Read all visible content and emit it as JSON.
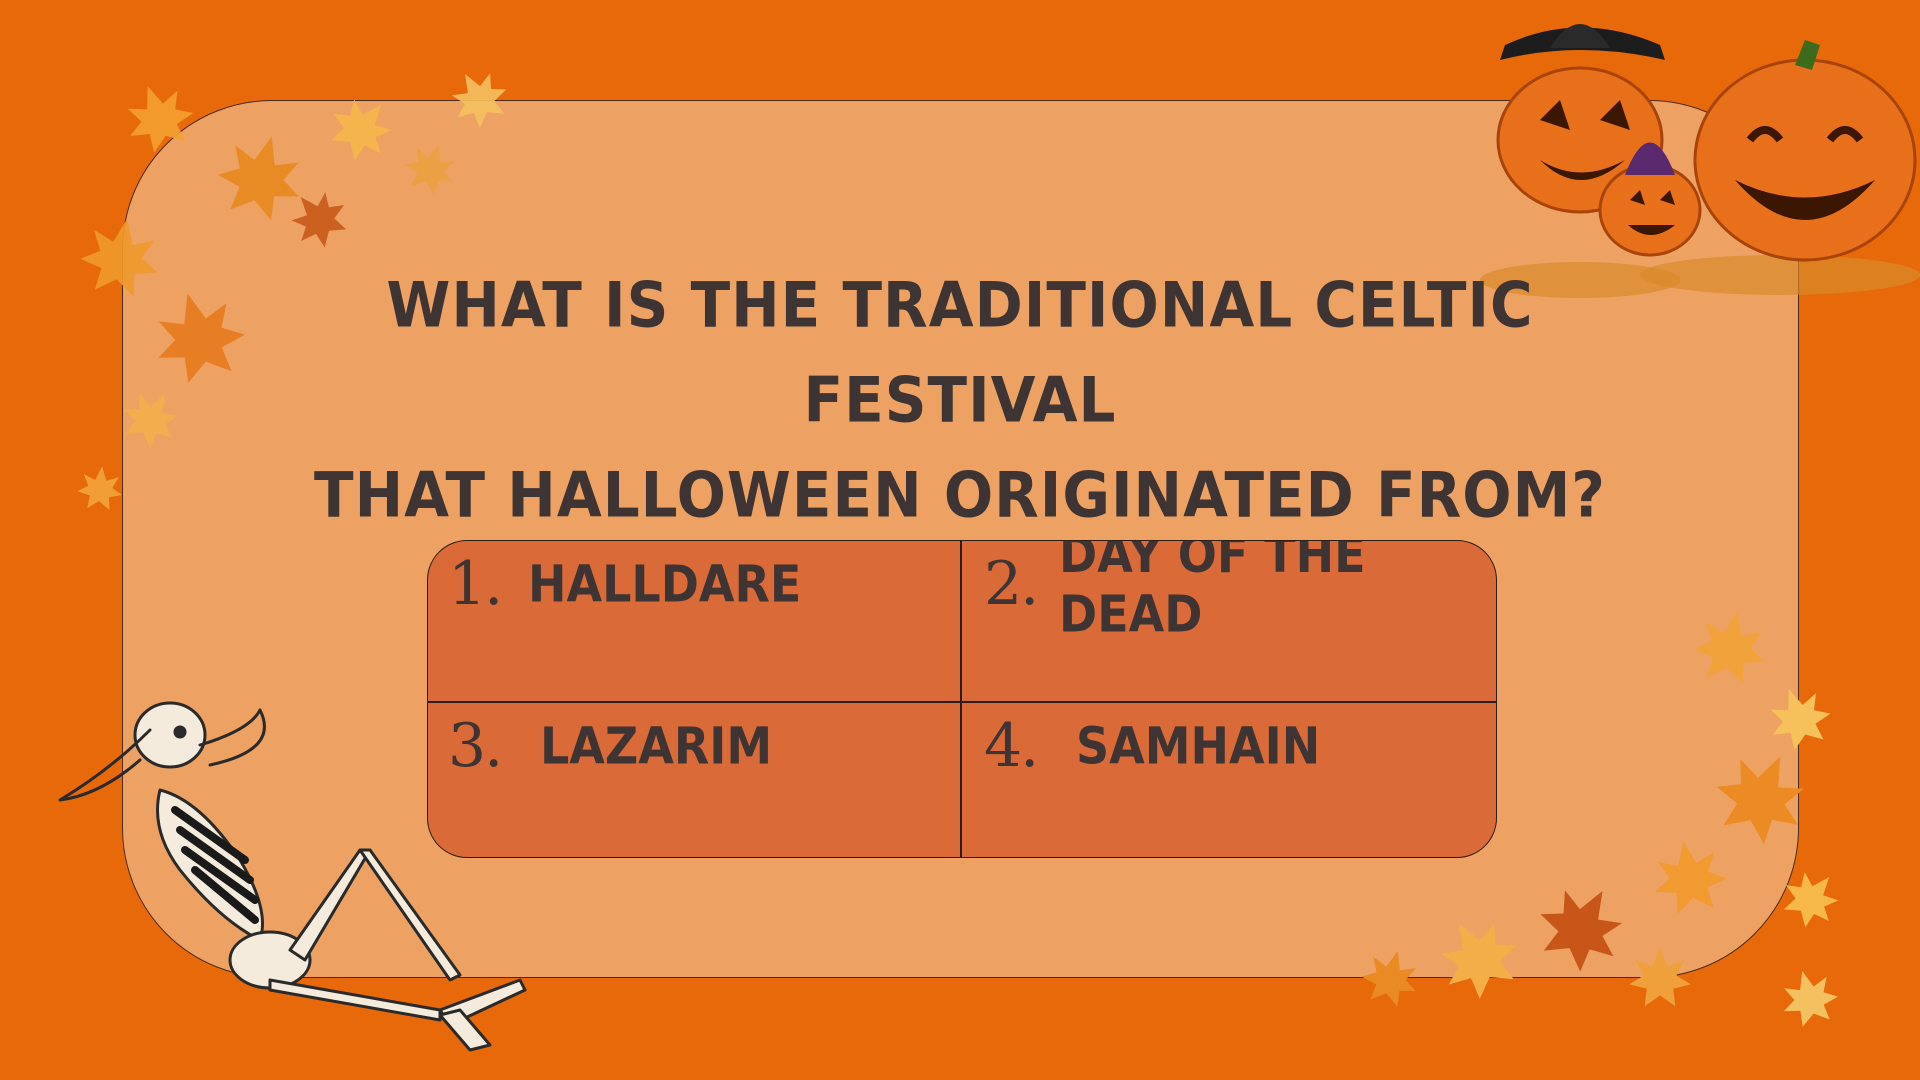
{
  "slide": {
    "question": {
      "line1": "WHAT IS THE TRADITIONAL CELTIC FESTIVAL",
      "line2": "THAT HALLOWEEN ORIGINATED FROM?"
    },
    "options": [
      {
        "number": "1.",
        "label": "HALLDARE"
      },
      {
        "number": "2.",
        "label": "DAY OF THE DEAD"
      },
      {
        "number": "3.",
        "label": "LAZARIM"
      },
      {
        "number": "4.",
        "label": "SAMHAIN"
      }
    ]
  },
  "decorations": {
    "top_left": "maple-leaves-cluster-icon",
    "top_right": "jack-o-lanterns-icon",
    "bottom_right": "maple-leaves-cluster-icon",
    "bottom_left": "reclining-skeleton-icon"
  },
  "colors": {
    "background": "#E8690A",
    "card": "#EDA264",
    "answer_box": "#DA6A37",
    "text": "#3f3434"
  }
}
